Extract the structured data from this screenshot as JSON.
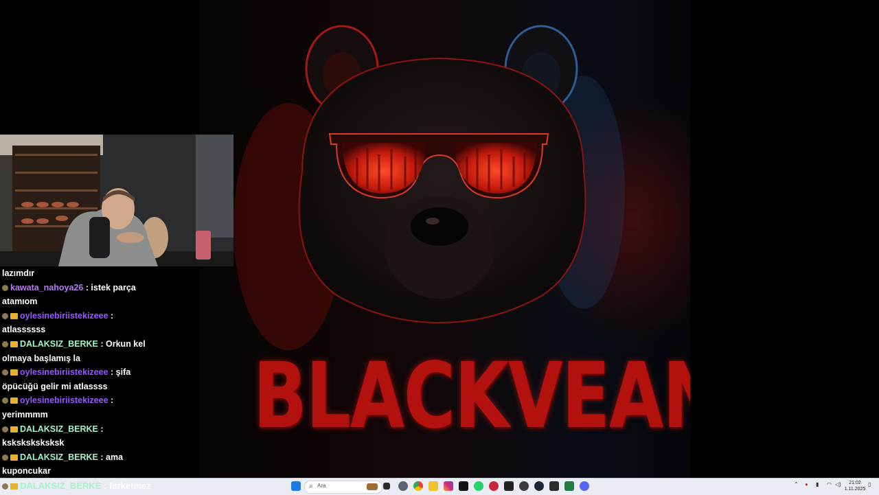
{
  "colors": {
    "chat_user_purple": "#b67cf0",
    "chat_user_green": "#a5f3c6",
    "chat_user_violet": "#9a58ff",
    "brand_red": "#b3110e",
    "taskbar_bg": "#e9edf3"
  },
  "artwork": {
    "title": "BLACKVEAN"
  },
  "chat": {
    "messages": [
      {
        "user": "",
        "text": "lazımdır",
        "color": "#ffffff",
        "badges": []
      },
      {
        "user": "kawata_nahoya26",
        "text": " : istek parça atamıom",
        "color": "#b67cf0",
        "badges": [
          "badge"
        ]
      },
      {
        "user": "oylesinebiriistekizeee",
        "text": " : atlassssss",
        "color": "#9a58ff",
        "badges": [
          "badge",
          "crown"
        ]
      },
      {
        "user": "DALAKSIZ_BERKE",
        "text": " : Orkun kel olmaya başlamış la",
        "color": "#a5f3c6",
        "badges": [
          "badge",
          "crown"
        ]
      },
      {
        "user": "oylesinebiriistekizeee",
        "text": " : şifa öpücüğü gelir mi atlassss",
        "color": "#9a58ff",
        "badges": [
          "badge",
          "crown"
        ]
      },
      {
        "user": "oylesinebiriistekizeee",
        "text": " : yerimmmm",
        "color": "#9a58ff",
        "badges": [
          "badge",
          "crown"
        ]
      },
      {
        "user": "DALAKSIZ_BERKE",
        "text": " : ksksksksksksk",
        "color": "#a5f3c6",
        "badges": [
          "badge",
          "crown"
        ]
      },
      {
        "user": "DALAKSIZ_BERKE",
        "text": " : ama kuponcukar",
        "color": "#a5f3c6",
        "badges": [
          "badge",
          "crown"
        ]
      }
    ],
    "bottom": {
      "user": "DALAKSIZ_BERKE",
      "text": ": farketmez"
    }
  },
  "taskbar": {
    "search_placeholder": "Ara",
    "search_icon": "search-icon",
    "apps": [
      "start-icon",
      "search-icon",
      "task-view-icon",
      "settings-icon",
      "chrome-icon",
      "file-explorer-icon",
      "instagram-icon",
      "tiktok-icon",
      "whatsapp-icon",
      "app-icon",
      "capcut-icon",
      "chatgpt-icon",
      "steam-icon",
      "store-icon",
      "excel-icon",
      "discord-icon"
    ],
    "clock_time": "21:02",
    "clock_date": "1.11.2025"
  }
}
